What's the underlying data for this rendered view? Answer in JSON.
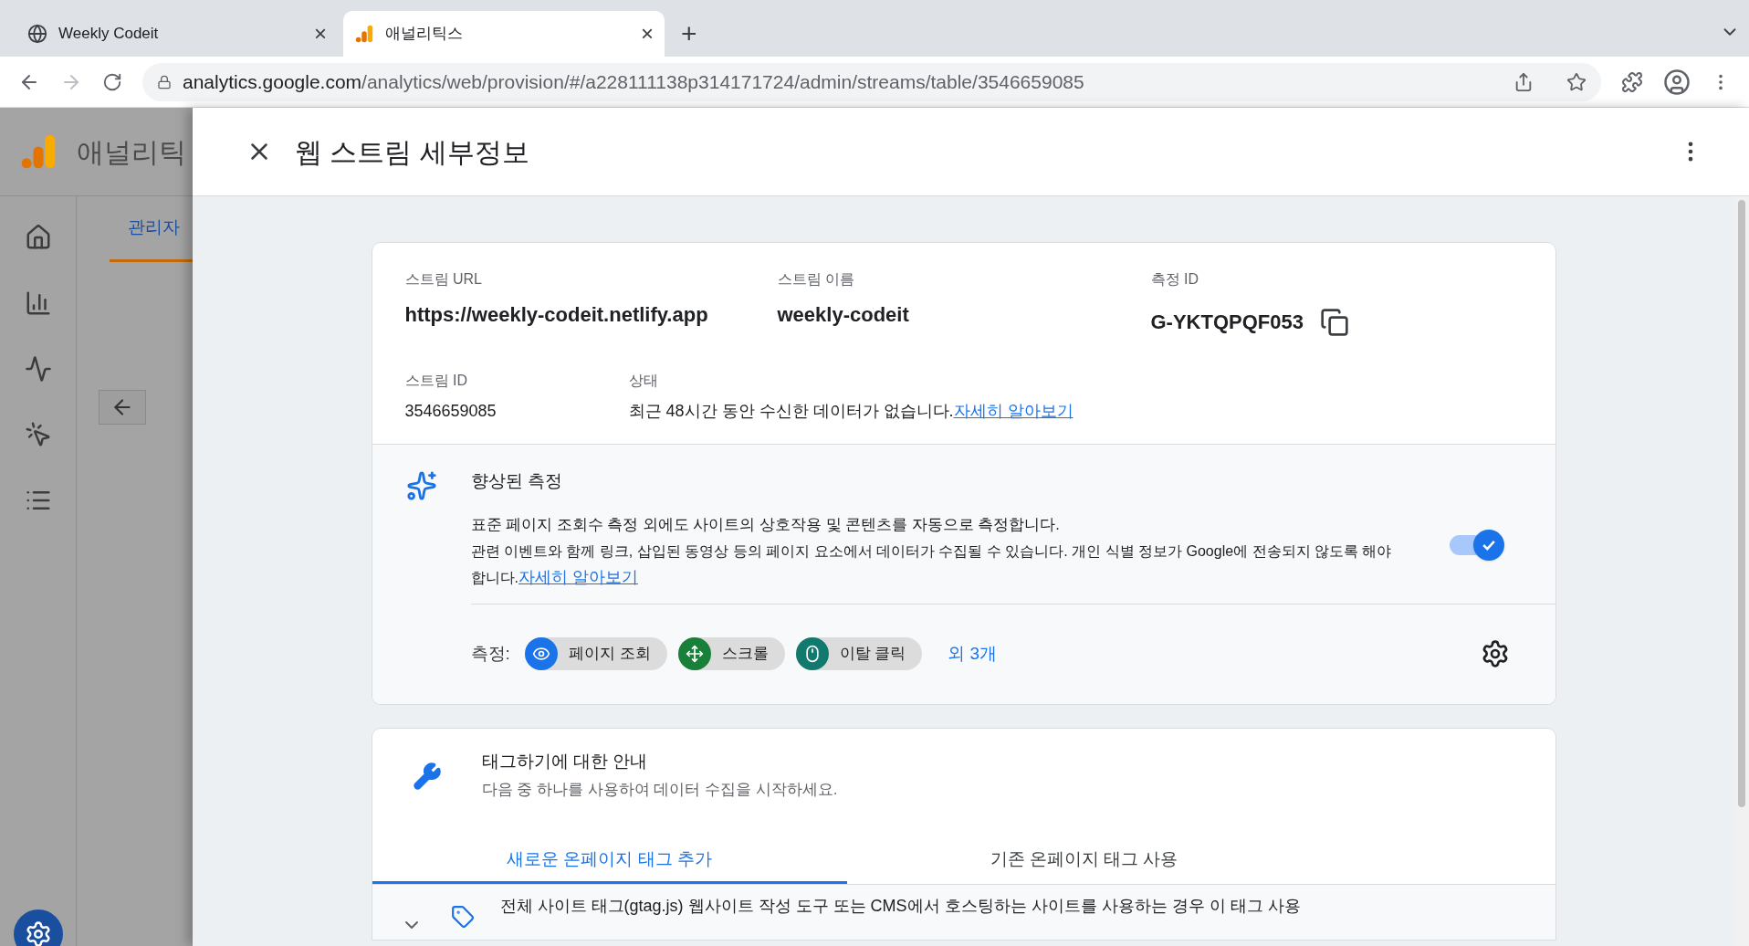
{
  "browser": {
    "tabs": [
      {
        "title": "Weekly Codeit",
        "kind": "globe",
        "selected": false,
        "close": "×"
      },
      {
        "title": "애널리틱스",
        "kind": "analytics",
        "selected": true,
        "close": "×"
      }
    ],
    "new_tab": "+",
    "url": {
      "host": "analytics.google.com",
      "path": "/analytics/web/provision/#/a228111138p314171724/admin/streams/table/3546659085"
    }
  },
  "background_app": {
    "title": "애널리틱",
    "admin_tab": "관리자"
  },
  "panel": {
    "title": "웹 스트림 세부정보"
  },
  "stream_details": {
    "fields": [
      {
        "label": "스트림 URL",
        "value": "https://weekly-codeit.netlify.app",
        "kind": "text"
      },
      {
        "label": "스트림 이름",
        "value": "weekly-codeit",
        "kind": "text"
      },
      {
        "label": "측정 ID",
        "value": "G-YKTQPQF053",
        "kind": "copy"
      }
    ],
    "stream_id": {
      "label": "스트림 ID",
      "value": "3546659085"
    },
    "status": {
      "label": "상태",
      "text": "최근 48시간 동안 수신한 데이터가 없습니다.",
      "link": "자세히 알아보기"
    }
  },
  "enhanced": {
    "title": "향상된 측정",
    "line_1": "표준 페이지 조회수 측정 외에도 사이트의 상호작용 및 콘텐츠를 자동으로 측정합니다.",
    "line_2": "관련 이벤트와 함께 링크, 삽입된 동영상 등의 페이지 요소에서 데이터가 수집될 수 있습니다. 개인 식별 정보가 Google에 전송되지 않도록 해야 합니다.",
    "link": "자세히 알아보기",
    "toggle_on": true,
    "measures_label": "측정:",
    "chips": [
      {
        "label": "페이지 조회",
        "kind": "eye",
        "color": "#1a73e8"
      },
      {
        "label": "스크롤",
        "kind": "scroll",
        "color": "#188038"
      },
      {
        "label": "이탈 클릭",
        "kind": "mouse",
        "color": "#12796e"
      }
    ],
    "more": "외 3개"
  },
  "tagging": {
    "title": "태그하기에 대한 안내",
    "subtitle": "다음 중 하나를 사용하여 데이터 수집을 시작하세요.",
    "tabs": [
      {
        "label": "새로운 온페이지 태그 추가",
        "selected": true
      },
      {
        "label": "기존 온페이지 태그 사용",
        "selected": false
      }
    ],
    "row": {
      "title": "전체 사이트 태그(gtag.js)",
      "text": "웹사이트 작성 도구 또는 CMS에서 호스팅하는 사이트를 사용하는 경우 이 태그 사용"
    }
  }
}
